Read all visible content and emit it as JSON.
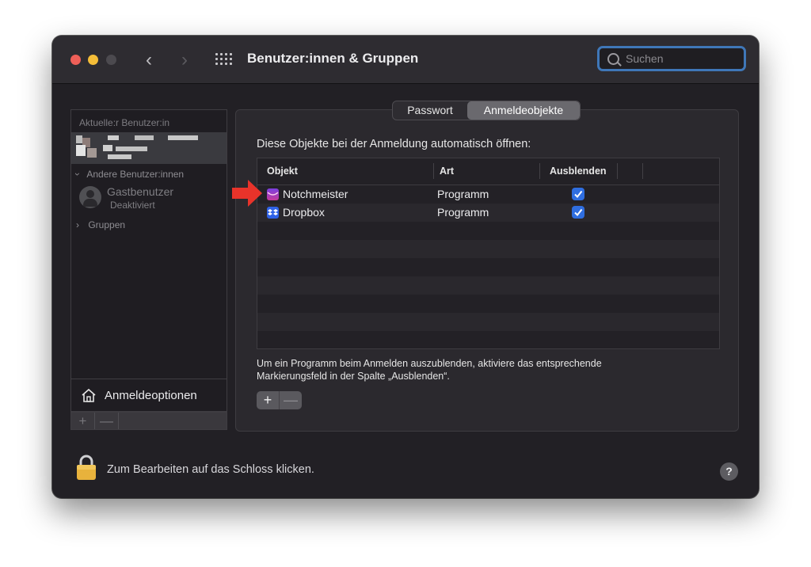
{
  "window": {
    "title": "Benutzer:innen & Gruppen",
    "search_placeholder": "Suchen"
  },
  "sidebar": {
    "current_label": "Aktuelle:r Benutzer:in",
    "other_users_label": "Andere Benutzer:innen",
    "guest_name": "Gastbenutzer",
    "guest_status": "Deaktiviert",
    "groups_label": "Gruppen",
    "login_options": "Anmeldeoptionen",
    "add": "+",
    "remove": "—"
  },
  "tabs": [
    {
      "label": "Passwort",
      "selected": false
    },
    {
      "label": "Anmeldeobjekte",
      "selected": true
    }
  ],
  "panel": {
    "intro": "Diese Objekte bei der Anmeldung automatisch öffnen:",
    "columns": [
      "Objekt",
      "Art",
      "Ausblenden"
    ],
    "rows": [
      {
        "name": "Notchmeister",
        "type": "Programm",
        "hidden": true,
        "icon": "notchmeister-app-icon"
      },
      {
        "name": "Dropbox",
        "type": "Programm",
        "hidden": true,
        "icon": "dropbox-app-icon"
      }
    ],
    "help": "Um ein Programm beim Anmelden auszublenden, aktiviere das entsprechende Markierungsfeld in der Spalte „Ausblenden“.",
    "add": "+",
    "remove": "—"
  },
  "footer": {
    "lock_text": "Zum Bearbeiten auf das Schloss klicken.",
    "help": "?"
  },
  "colors": {
    "accent": "#2f6ee0",
    "annotation_arrow": "#e8332a"
  }
}
